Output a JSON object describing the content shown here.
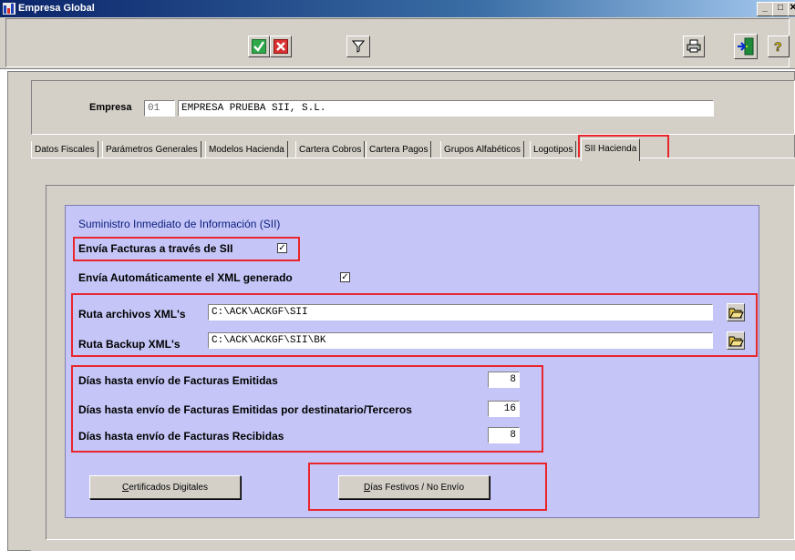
{
  "window": {
    "title": "Empresa Global"
  },
  "toolbar": {
    "accept_icon": "check-icon",
    "cancel_icon": "cancel-icon",
    "filter_icon": "filter-icon",
    "print_icon": "printer-icon",
    "exit_icon": "exit-door-icon",
    "help_icon": "help-icon"
  },
  "header": {
    "empresa_label": "Empresa",
    "empresa_code": "01",
    "empresa_name": "EMPRESA PRUEBA SII, S.L."
  },
  "tabs": [
    {
      "label": "Datos Fiscales"
    },
    {
      "label": "Parámetros Generales"
    },
    {
      "label": "Modelos Hacienda"
    },
    {
      "label": "Cartera Cobros"
    },
    {
      "label": "Cartera Pagos"
    },
    {
      "label": "Grupos Alfabéticos"
    },
    {
      "label": "Logotipos"
    },
    {
      "label": "SII Hacienda",
      "active": true
    }
  ],
  "sii": {
    "title": "Suministro Inmediato de Información  (SII)",
    "envia_facturas_label": "Envía Facturas a través de SII",
    "envia_facturas_checked": true,
    "envia_auto_label": "Envía Automáticamente el XML generado",
    "envia_auto_checked": true,
    "ruta_xml_label": "Ruta archivos XML's",
    "ruta_xml_value": "C:\\ACK\\ACKGF\\SII",
    "ruta_backup_label": "Ruta Backup  XML's",
    "ruta_backup_value": "C:\\ACK\\ACKGF\\SII\\BK",
    "dias_emitidas_label": "Días hasta envío de Facturas Emitidas",
    "dias_emitidas_value": "8",
    "dias_terceros_label": "Días hasta envío de Facturas Emitidas por destinatario/Terceros",
    "dias_terceros_value": "16",
    "dias_recibidas_label": "Días hasta envío de Facturas Recibidas",
    "dias_recibidas_value": "8",
    "certificados_label": "Certificados Digitales",
    "festivos_label": "Días Festivos / No Envío"
  },
  "colors": {
    "highlight_red": "#e8262b",
    "sii_panel_bg": "#c5c6f7",
    "sii_title": "#0b1c7e"
  }
}
